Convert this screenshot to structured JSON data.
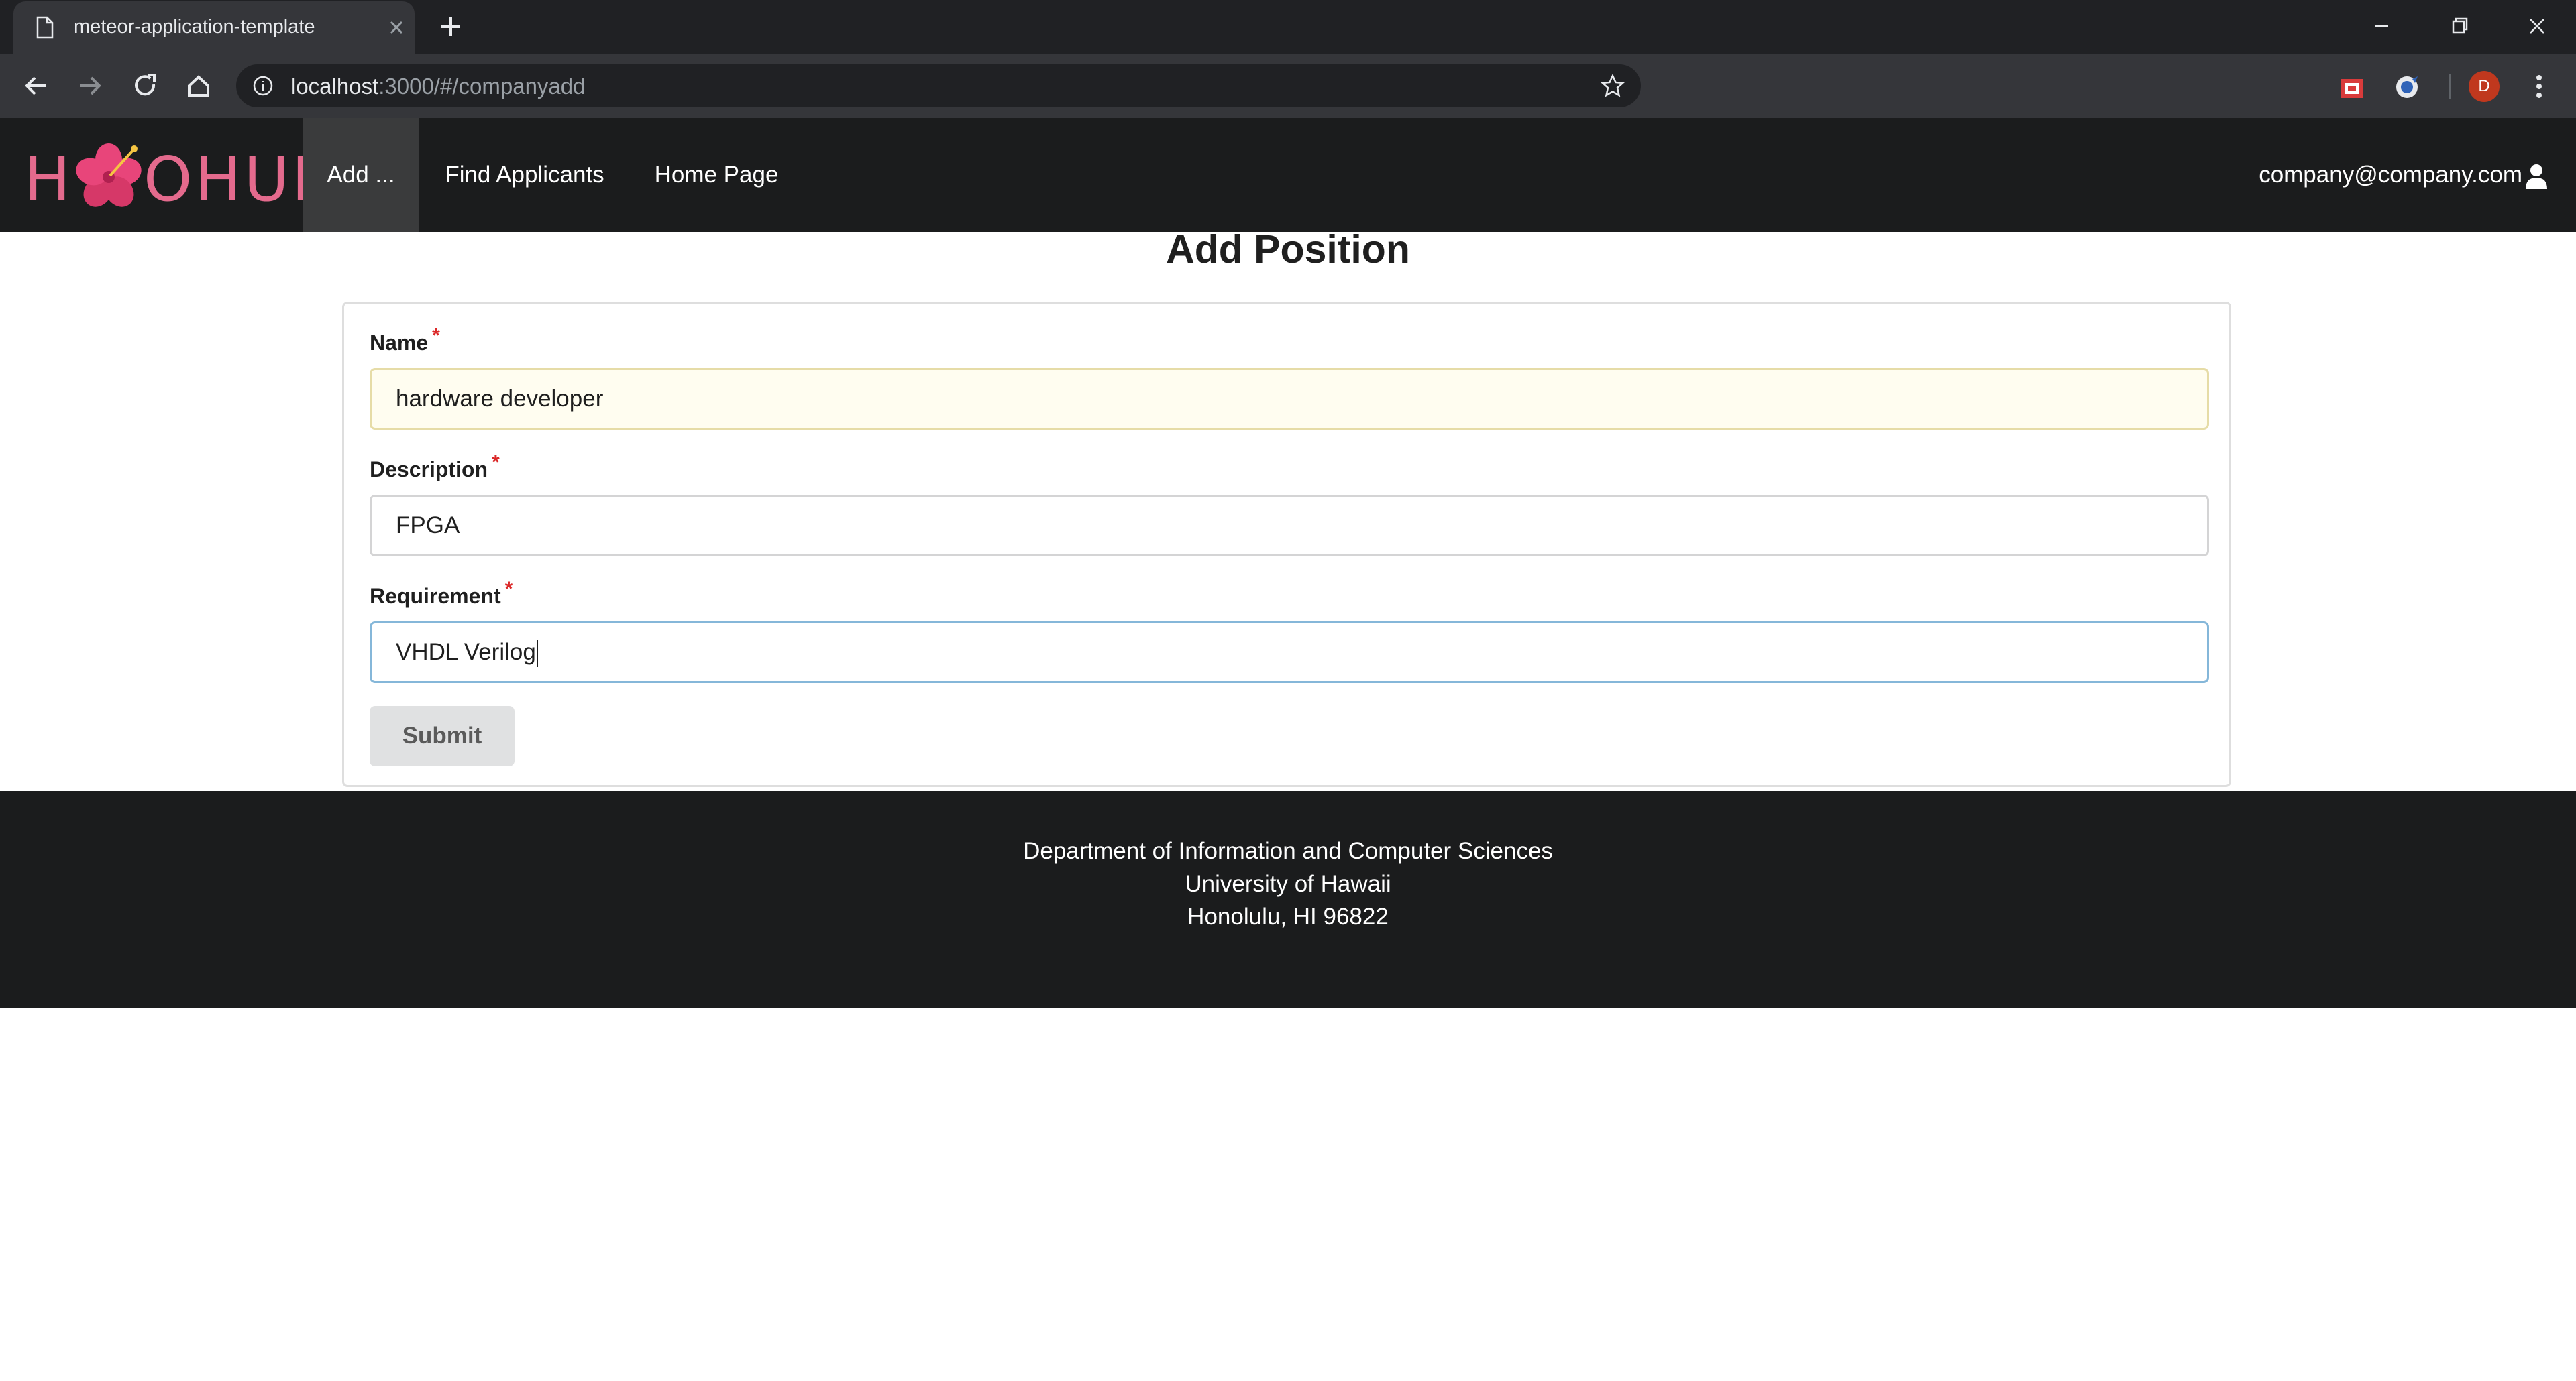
{
  "browser": {
    "tab_title": "meteor-application-template",
    "url_host": "localhost",
    "url_path": ":3000/#/companyadd",
    "profile_initial": "D"
  },
  "navbar": {
    "logo_text": "H  OHUI",
    "items": [
      {
        "label": "Add ...",
        "active": true
      },
      {
        "label": "Find Applicants",
        "active": false
      },
      {
        "label": "Home Page",
        "active": false
      }
    ],
    "user_email": "company@company.com"
  },
  "page": {
    "title": "Add Position"
  },
  "form": {
    "name_label": "Name",
    "name_value": "hardware developer",
    "description_label": "Description",
    "description_value": "FPGA",
    "requirement_label": "Requirement",
    "requirement_value": "VHDL Verilog",
    "required_marker": "*",
    "submit_label": "Submit"
  },
  "footer": {
    "line1": "Department of Information and Computer Sciences",
    "line2": "University of Hawaii",
    "line3": "Honolulu, HI 96822"
  },
  "colors": {
    "navbar_bg": "#1b1c1d",
    "logo_pink": "#e46a8d",
    "required_red": "#db2828",
    "focus_border": "#85b7d9"
  }
}
